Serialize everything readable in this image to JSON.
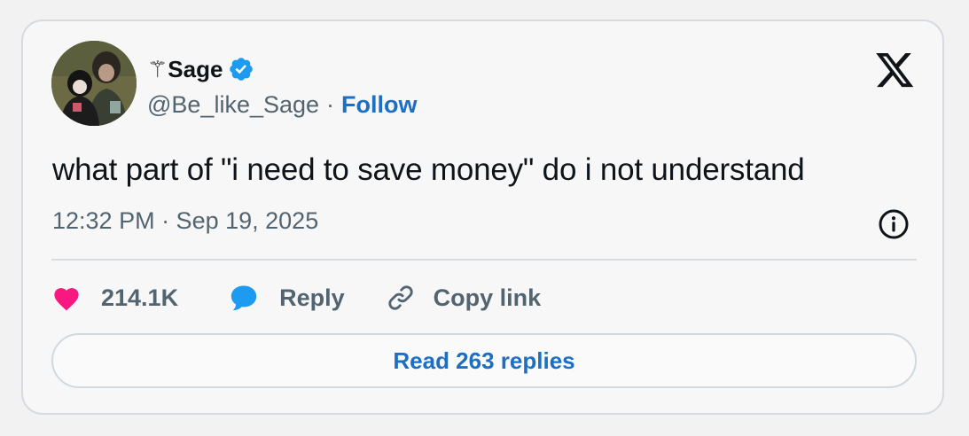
{
  "author": {
    "display_name": "⚚Sage",
    "handle": "@Be_like_Sage",
    "separator": "·",
    "follow_label": "Follow",
    "verified": true
  },
  "tweet": {
    "text": "what part of \"i need to save money\" do i not understand",
    "timestamp": "12:32 PM · Sep 19, 2025"
  },
  "actions": {
    "like_count": "214.1K",
    "reply_label": "Reply",
    "copy_link_label": "Copy link"
  },
  "read_replies_label": "Read 263 replies",
  "icons": {
    "brand": "x-logo-icon",
    "verified": "verified-badge-icon",
    "info": "info-icon",
    "like": "heart-icon",
    "reply": "speech-bubble-icon",
    "copy": "link-icon"
  },
  "colors": {
    "like": "#f91880",
    "reply": "#1d9bf0",
    "follow": "#1d6fc4",
    "verified": "#1d9bf0"
  }
}
